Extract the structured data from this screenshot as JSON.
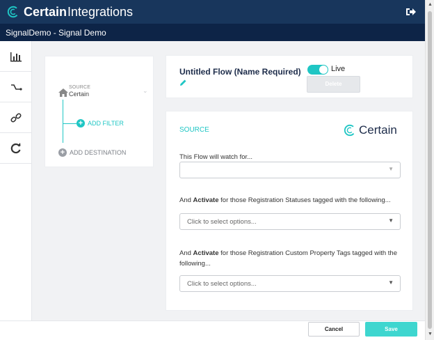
{
  "app": {
    "brand": "Certain",
    "section": "Integrations",
    "breadcrumb": "SignalDemo - Signal Demo"
  },
  "icons": {
    "logo": "certain-logo-icon",
    "logout": "logout-icon",
    "sidebar": [
      "bar-chart-icon",
      "signal-icon",
      "link-icon",
      "refresh-icon"
    ]
  },
  "flow_tree": {
    "source_label": "SOURCE",
    "source_value": "Certain",
    "add_filter": "ADD FILTER",
    "add_destination": "ADD DESTINATION"
  },
  "flow_header": {
    "title": "Untitled Flow (Name Required)",
    "toggle_label": "Live",
    "toggle_on": true,
    "delete_label": "Delete"
  },
  "source_panel": {
    "heading": "SOURCE",
    "logo_text": "Certain",
    "watch_label": "This Flow will watch for...",
    "watch_value": "",
    "status_prefix": "And ",
    "status_bold": "Activate",
    "status_suffix": " for those Registration Statuses tagged with the following...",
    "status_placeholder": "Click to select options...",
    "custom_prefix": "And ",
    "custom_bold": "Activate",
    "custom_suffix": " for those Registration Custom Property Tags tagged with the following...",
    "custom_placeholder": "Click to select options..."
  },
  "footer": {
    "cancel_label": "Cancel",
    "save_label": "Save"
  },
  "colors": {
    "header": "#18365c",
    "subheader": "#0d2447",
    "accent": "#1fc6c4",
    "save": "#3ed6cf"
  }
}
